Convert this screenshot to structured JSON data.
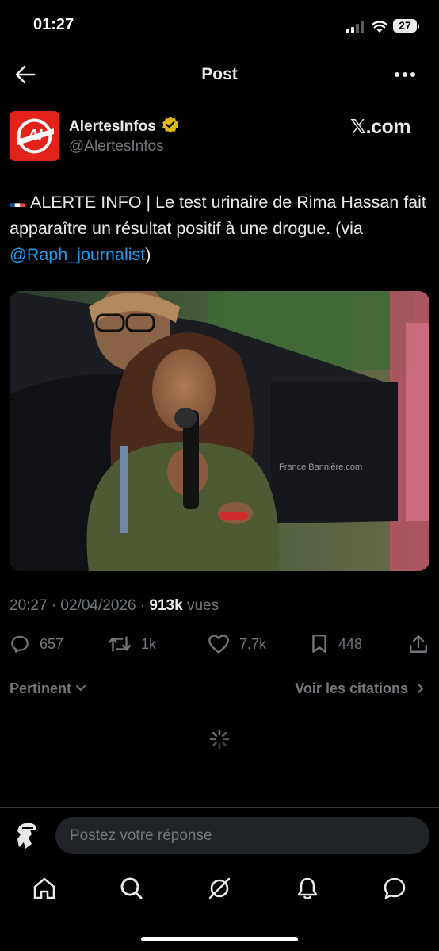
{
  "status_bar": {
    "time": "01:27",
    "battery": "27",
    "icons": [
      "signal-icon",
      "wifi-icon",
      "battery-icon"
    ]
  },
  "header": {
    "title": "Post",
    "back_icon": "arrow-left-icon",
    "more_icon": "more-dots-icon"
  },
  "author": {
    "name": "AlertesInfos",
    "handle": "@AlertesInfos",
    "avatar_text": "AI",
    "verified": true,
    "badge_color": "#e2b719"
  },
  "source_label": "𝕏.com",
  "tweet": {
    "flag": "french-flag-icon",
    "text_before": "ALERTE INFO | Le test urinaire de Rima Hassan fait apparaître un résultat positif à une drogue. (via ",
    "mention": "@Raph_journalist",
    "text_after": ")",
    "media_caption": "France Bannière.com"
  },
  "meta": {
    "time_date": "20:27 · 02/04/2026 · ",
    "views_count": "913k",
    "views_label": "vues"
  },
  "actions": {
    "replies": "657",
    "reposts": "1k",
    "likes": "7,7k",
    "bookmarks": "448"
  },
  "sort": {
    "label": "Pertinent",
    "quotes_link": "Voir les citations"
  },
  "reply": {
    "placeholder": "Postez votre réponse"
  },
  "bottom_nav": [
    "home-icon",
    "search-icon",
    "grok-icon",
    "notifications-icon",
    "messages-icon"
  ],
  "colors": {
    "accent": "#1d9bf0",
    "muted": "#71767b",
    "brand_red": "#e32219"
  }
}
